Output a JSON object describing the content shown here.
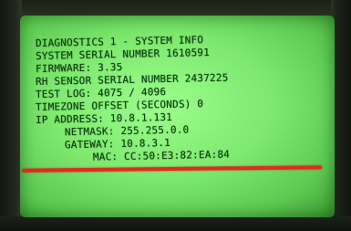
{
  "screen": {
    "lines": [
      "DIAGNOSTICS 1 - SYSTEM INFO",
      "SYSTEM SERIAL NUMBER 1610591",
      "FIRMWARE: 3.35",
      "RH SENSOR SERIAL NUMBER 2437225",
      "TEST LOG: 4075 / 4096",
      "TIMEZONE OFFSET (SECONDS) 0",
      "IP ADDRESS: 10.8.1.131",
      "NETMASK: 255.255.0.0",
      "GATEWAY: 10.8.3.1",
      "MAC: CC:50:E3:82:EA:84"
    ]
  },
  "colors": {
    "screen_green": "#7ee86f",
    "text": "#0a3a0c",
    "annotation_red": "#e02a22"
  }
}
